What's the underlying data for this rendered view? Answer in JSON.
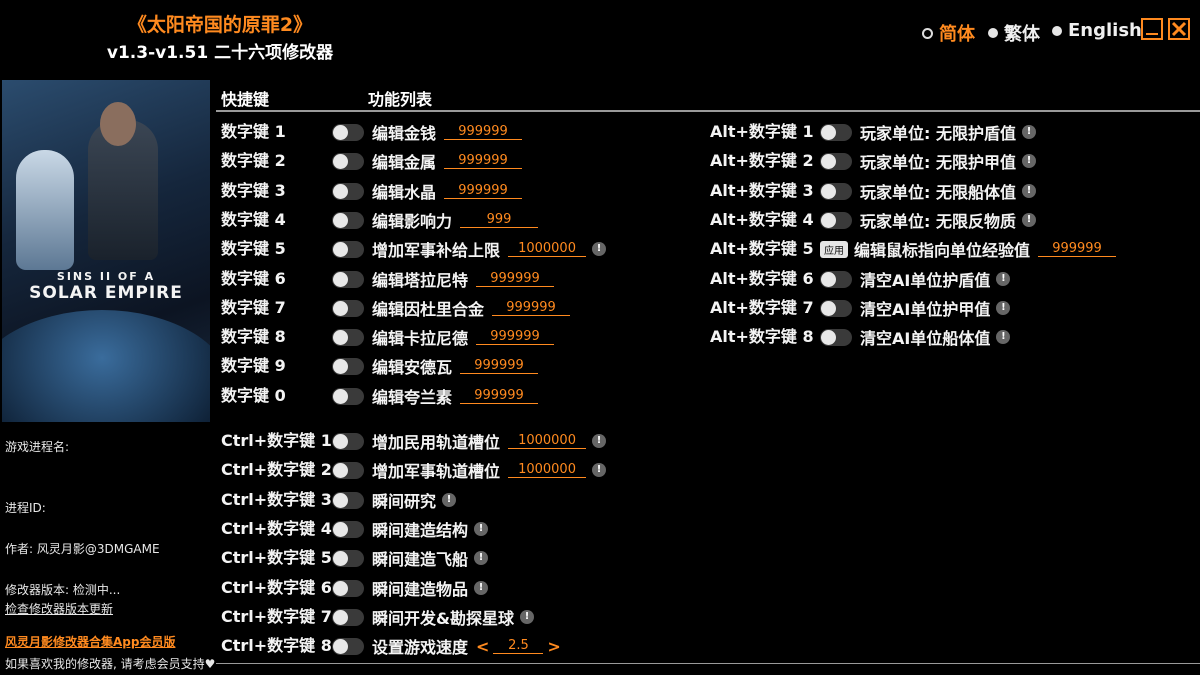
{
  "header": {
    "title": "《太阳帝国的原罪2》",
    "subtitle": "v1.3-v1.51 二十六项修改器"
  },
  "languages": [
    {
      "label": "简体",
      "selected": true
    },
    {
      "label": "繁体",
      "selected": false
    },
    {
      "label": "English",
      "selected": false
    }
  ],
  "window_buttons": {
    "minimize": "minimize-icon",
    "close": "close-icon"
  },
  "cover": {
    "logo_line1": "SINS II OF A",
    "logo_line2": "SOLAR EMPIRE"
  },
  "info": {
    "process_label": "游戏进程名:",
    "pid_label": "进程ID:",
    "author": "作者: 风灵月影@3DMGAME",
    "version": "修改器版本: 检测中...",
    "check_update": "检查修改器版本更新",
    "promo": "风灵月影修改器合集App会员版",
    "support": "如果喜欢我的修改器, 请考虑会员支持♥"
  },
  "columns": {
    "hotkey": "快捷键",
    "features": "功能列表"
  },
  "left_rows": [
    {
      "key": "数字键 1",
      "label": "编辑金钱",
      "value": "999999"
    },
    {
      "key": "数字键 2",
      "label": "编辑金属",
      "value": "999999"
    },
    {
      "key": "数字键 3",
      "label": "编辑水晶",
      "value": "999999"
    },
    {
      "key": "数字键 4",
      "label": "编辑影响力",
      "value": "999"
    },
    {
      "key": "数字键 5",
      "label": "增加军事补给上限",
      "value": "1000000",
      "warn": true
    },
    {
      "key": "数字键 6",
      "label": "编辑塔拉尼特",
      "value": "999999"
    },
    {
      "key": "数字键 7",
      "label": "编辑因杜里合金",
      "value": "999999"
    },
    {
      "key": "数字键 8",
      "label": "编辑卡拉尼德",
      "value": "999999"
    },
    {
      "key": "数字键 9",
      "label": "编辑安德瓦",
      "value": "999999"
    },
    {
      "key": "数字键 0",
      "label": "编辑夸兰素",
      "value": "999999"
    }
  ],
  "ctrl_rows": [
    {
      "key": "Ctrl+数字键 1",
      "label": "增加民用轨道槽位",
      "value": "1000000",
      "warn": true
    },
    {
      "key": "Ctrl+数字键 2",
      "label": "增加军事轨道槽位",
      "value": "1000000",
      "warn": true
    },
    {
      "key": "Ctrl+数字键 3",
      "label": "瞬间研究",
      "warn": true
    },
    {
      "key": "Ctrl+数字键 4",
      "label": "瞬间建造结构",
      "warn": true
    },
    {
      "key": "Ctrl+数字键 5",
      "label": "瞬间建造飞船",
      "warn": true
    },
    {
      "key": "Ctrl+数字键 6",
      "label": "瞬间建造物品",
      "warn": true
    },
    {
      "key": "Ctrl+数字键 7",
      "label": "瞬间开发&勘探星球",
      "warn": true
    },
    {
      "key": "Ctrl+数字键 8",
      "label": "设置游戏速度",
      "value": "2.5",
      "arrows": true
    }
  ],
  "alt_rows": [
    {
      "key": "Alt+数字键 1",
      "label": "玩家单位: 无限护盾值",
      "warn": true
    },
    {
      "key": "Alt+数字键 2",
      "label": "玩家单位: 无限护甲值",
      "warn": true
    },
    {
      "key": "Alt+数字键 3",
      "label": "玩家单位: 无限船体值",
      "warn": true
    },
    {
      "key": "Alt+数字键 4",
      "label": "玩家单位: 无限反物质",
      "warn": true
    },
    {
      "key": "Alt+数字键 5",
      "label": "编辑鼠标指向单位经验值",
      "value": "999999",
      "apply": "应用"
    },
    {
      "key": "Alt+数字键 6",
      "label": "清空AI单位护盾值",
      "warn": true
    },
    {
      "key": "Alt+数字键 7",
      "label": "清空AI单位护甲值",
      "warn": true
    },
    {
      "key": "Alt+数字键 8",
      "label": "清空AI单位船体值",
      "warn": true
    }
  ],
  "speed_arrows": {
    "left": "<",
    "right": ">"
  },
  "warn_glyph": "!",
  "colors": {
    "accent": "#ff8a1f",
    "background": "#000000",
    "text": "#f0f0f0"
  }
}
